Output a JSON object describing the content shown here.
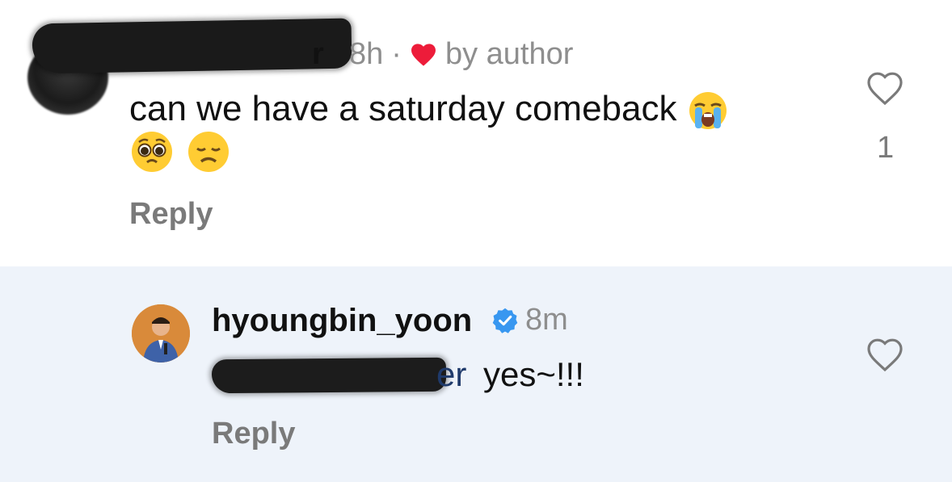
{
  "comment": {
    "username_visible_tail": "r",
    "time": "8h",
    "separator": "·",
    "liked_by_author_label": "by author",
    "text": "can we have a saturday comeback",
    "reply_label": "Reply",
    "like_count": "1",
    "emojis": [
      "loudly-crying-face",
      "pleading-face",
      "disappointed-face"
    ]
  },
  "reply": {
    "username": "hyoungbin_yoon",
    "time": "8m",
    "mention_visible_tail": "er",
    "text": "yes~!!!",
    "reply_label": "Reply"
  },
  "colors": {
    "heart_red": "#ed1c3a",
    "verified_blue": "#3897f0",
    "muted_text": "#8e8e8e",
    "reply_background": "#eef3fa",
    "mention_blue": "#1f3a6b"
  }
}
